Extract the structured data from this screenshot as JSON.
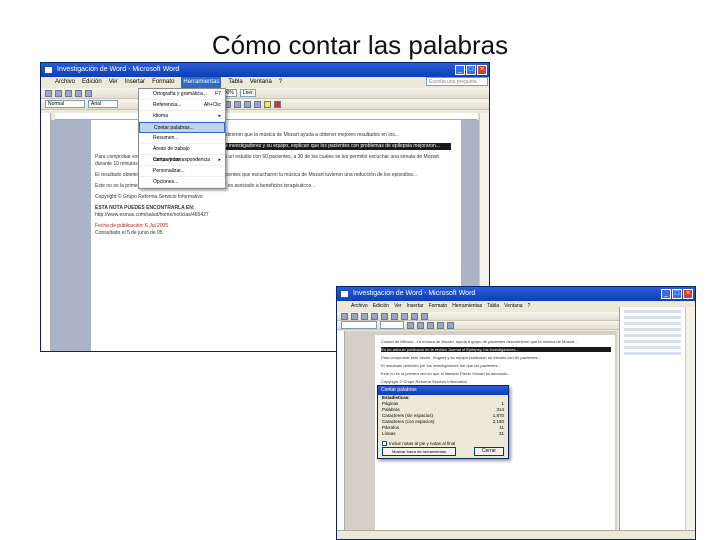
{
  "slide_title": "Cómo contar las palabras",
  "window1": {
    "title": "Investigación de Word - Microsoft Word",
    "menus": [
      "Archivo",
      "Edición",
      "Ver",
      "Insertar",
      "Formato",
      "Herramientas",
      "Tabla",
      "Ventana",
      "?"
    ],
    "active_menu": "Herramientas",
    "style_box": "Normal",
    "font_box": "Arial",
    "zoom": "100%",
    "read_button": "Leer",
    "search_placeholder": "Escriba una pregunta",
    "tools_menu": [
      {
        "label": "Ortografía y gramática...",
        "shortcut": "F7"
      },
      {
        "label": "Referencia...",
        "shortcut": "Alt+Clic"
      },
      {
        "label": "Idioma",
        "shortcut": "▸"
      },
      {
        "label": "Contar palabras...",
        "shortcut": ""
      },
      {
        "label": "Resumen...",
        "shortcut": ""
      },
      {
        "label": "Áreas de trabajo compartidas...",
        "shortcut": ""
      },
      {
        "label": "Cartas y correspondencia",
        "shortcut": "▸"
      },
      {
        "label": "Personalizar...",
        "shortcut": ""
      },
      {
        "label": "Opciones...",
        "shortcut": ""
      }
    ],
    "paragraphs": [
      "...A y su grupo de pacientes descubrieron que la música de Mozart ayuda a obtener mejores resultados en los...",
      "...la revista Journal of Epilepsy, los investigadores y su equipo, explican que los pacientes con problemas de epilepsia mejoraron...",
      "Para comprobar este hecho, Hughes y su equipo realizaron un estudio con 60 pacientes, a 30 de los cuales se les permitió escuchar una sonata de Mozart durante 10 minutos al día...",
      "El resultado obtenido por los investigadores fue que los pacientes que escucharon la música de Mozart tuvieron una reducción de los episodios...",
      "Este no es la primera vez en que el llamado 'Efecto Mozart' es asociado a beneficios terapéuticos...",
      "Copyright © Grupo Reforma Servicio Informativo",
      "ESTA NOTA PUEDES ENCONTRARLA EN:",
      "http://www.esmas.com/salud/home/noticias/465427",
      "Fecha de publicación: 6 Jul 2005",
      "Consultado el 5 de junio de 05"
    ],
    "link_word": "Mozart"
  },
  "window2": {
    "title": "Investigación de Word - Microsoft Word",
    "menus": [
      "Archivo",
      "Edición",
      "Ver",
      "Insertar",
      "Formato",
      "Herramientas",
      "Tabla",
      "Ventana",
      "?"
    ],
    "dialog": {
      "title": "Contar palabras",
      "heading": "Estadísticas:",
      "stats": [
        {
          "label": "Páginas",
          "value": "1"
        },
        {
          "label": "Palabras",
          "value": "314"
        },
        {
          "label": "Caracteres (sin espacios)",
          "value": "1,870"
        },
        {
          "label": "Caracteres (con espacios)",
          "value": "2,180"
        },
        {
          "label": "Párrafos",
          "value": "11"
        },
        {
          "label": "Líneas",
          "value": "31"
        }
      ],
      "checkbox": "Incluir notas al pie y notas al final",
      "toolbar_button": "Mostrar barra de herramientas",
      "close_button": "Cerrar"
    },
    "paragraphs": [
      "Ciudad de México.- La música de Mozart, ayuda a grupo de pacientes descubrieron que la música de Mozart...",
      "En un artículo publicado en la revista Journal of Epilepsy, los investigadores...",
      "Para comprobar este hecho, Hughes y su equipo realizaron un estudio con 60 pacientes...",
      "El resultado obtenido por los investigadores fue que los pacientes...",
      "Este no es la primera vez en que el llamado Efecto Mozart es asociado...",
      "Copyright © Grupo Reforma Servicio Informativo",
      "ESTA NOTA PUEDES ENCONTRARLA EN:",
      "http://www.esmas.com/salud/home/noticias/465427",
      "Fecha de publicación: 6 Jul 2005",
      "Consultado el 5 de junio de 05"
    ]
  }
}
